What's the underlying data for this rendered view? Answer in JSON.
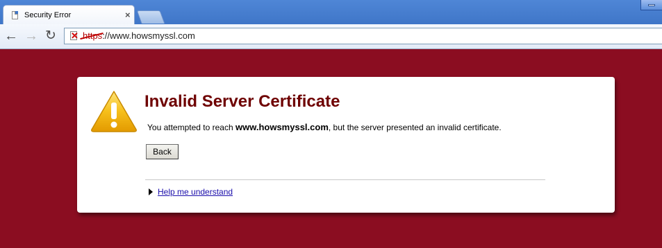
{
  "tab": {
    "title": "Security Error",
    "close_glyph": "×"
  },
  "toolbar": {
    "back_glyph": "←",
    "forward_glyph": "→",
    "reload_glyph": "↻",
    "url_scheme": "https",
    "url_rest": "://www.howsmyssl.com"
  },
  "error": {
    "title": "Invalid Server Certificate",
    "message_before": "You attempted to reach ",
    "host": "www.howsmyssl.com",
    "message_after": ", but the server presented an invalid certificate.",
    "back_label": "Back",
    "help_link": "Help me understand"
  },
  "colors": {
    "page_background": "#8b0d21",
    "heading": "#6e0000",
    "warning_icon": "#f4b400"
  },
  "icons": [
    "page-icon",
    "close-icon",
    "back-arrow-icon",
    "forward-arrow-icon",
    "reload-icon",
    "broken-lock-icon",
    "warning-icon",
    "disclosure-triangle-icon"
  ]
}
